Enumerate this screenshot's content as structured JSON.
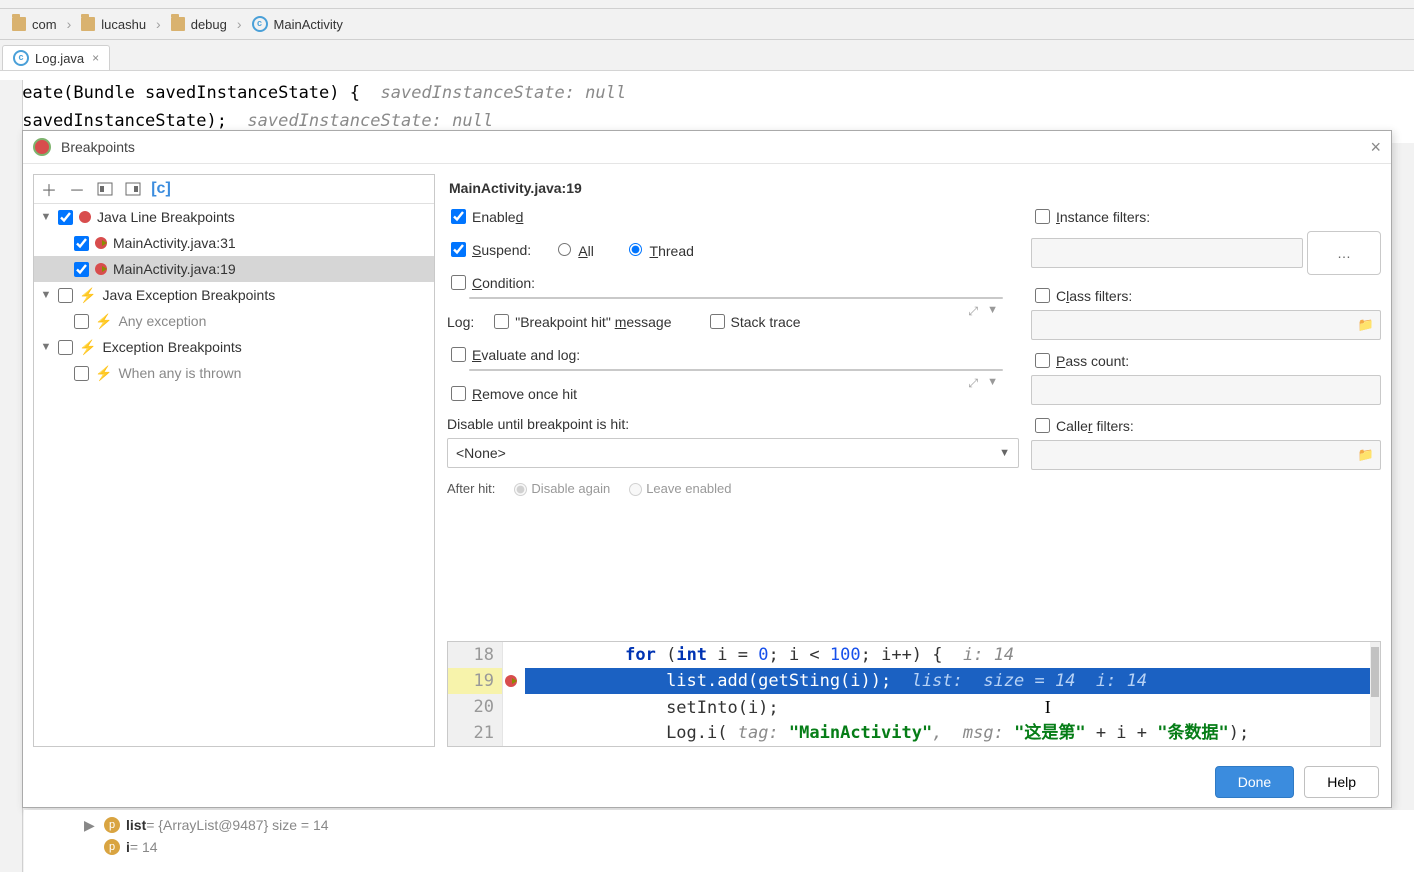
{
  "breadcrumb": [
    "com",
    "lucashu",
    "debug",
    "MainActivity"
  ],
  "tab": {
    "name": "Log.java"
  },
  "bg_code": {
    "line1_a": "reate(Bundle savedInstanceState) {",
    "line1_hint": "savedInstanceState: null",
    "line2_a": "(savedInstanceState);",
    "line2_hint": "savedInstanceState: null"
  },
  "dialog": {
    "title": "Breakpoints",
    "tree": {
      "java_line": "Java Line Breakpoints",
      "bp1": "MainActivity.java:31",
      "bp2": "MainActivity.java:19",
      "java_exc": "Java Exception Breakpoints",
      "any_exc": "Any exception",
      "exc": "Exception Breakpoints",
      "when_any": "When any is thrown"
    },
    "settings": {
      "title": "MainActivity.java:19",
      "enabled": "Enabled",
      "suspend": "Suspend:",
      "suspend_all": "All",
      "suspend_thread": "Thread",
      "condition": "Condition:",
      "log": "Log:",
      "log_bp": "\"Breakpoint hit\" message",
      "log_stack": "Stack trace",
      "eval": "Evaluate and log:",
      "remove": "Remove once hit",
      "disable_until": "Disable until breakpoint is hit:",
      "disable_until_val": "<None>",
      "after_hit": "After hit:",
      "after_disable": "Disable again",
      "after_leave": "Leave enabled",
      "inst_filters": "Instance filters:",
      "class_filters": "Class filters:",
      "pass_count": "Pass count:",
      "caller_filters": "Caller filters:"
    },
    "code": {
      "ln18": "18",
      "c18_a": "for",
      "c18_b": " (",
      "c18_c": "int",
      "c18_d": " i = ",
      "c18_e": "0",
      "c18_f": "; i < ",
      "c18_g": "100",
      "c18_h": "; i++) {",
      "c18_hint": "  i: 14",
      "ln19": "19",
      "c19": "list.add(getSting(i));",
      "c19_hint": "  list:  size = 14  i: 14",
      "ln20": "20",
      "c20": "setInto(i);",
      "ln21": "21",
      "c21_a": "Log.i(",
      "c21_tag": " tag: ",
      "c21_s1": "\"MainActivity\"",
      "c21_m": ",  msg: ",
      "c21_s2": "\"这是第\"",
      "c21_p": " + i + ",
      "c21_s3": "\"条数据\"",
      "c21_e": ");"
    },
    "done": "Done",
    "help": "Help"
  },
  "vars": {
    "list_name": "list",
    "list_val": " = {ArrayList@9487}  size = 14",
    "i_name": "i",
    "i_val": " = 14"
  }
}
